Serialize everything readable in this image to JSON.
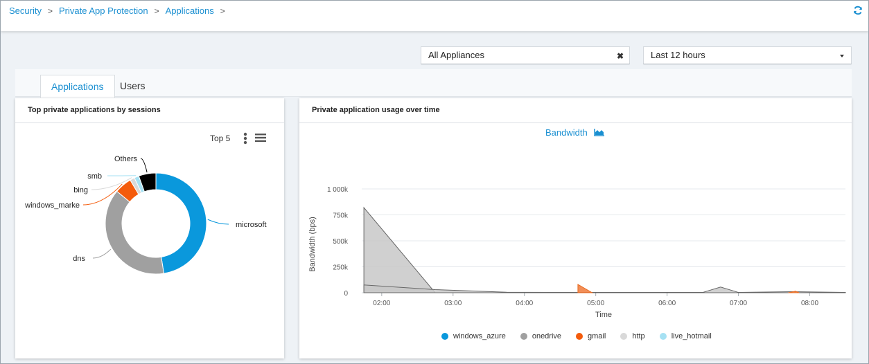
{
  "breadcrumb": {
    "items": [
      "Security",
      "Private App Protection",
      "Applications"
    ],
    "separator": ">"
  },
  "filters": {
    "appliances": {
      "value": "All Appliances"
    },
    "time_range": {
      "value": "Last 12 hours"
    }
  },
  "tabs": [
    {
      "label": "Applications",
      "active": true
    },
    {
      "label": "Users",
      "active": false
    }
  ],
  "left_card": {
    "title": "Top private applications by sessions",
    "top_n_label": "Top 5"
  },
  "right_card": {
    "title": "Private application usage over time",
    "metric_label": "Bandwidth"
  },
  "icons": {
    "refresh": "refresh-icon",
    "clear": "clear-icon",
    "dropdown": "caret-down-icon",
    "more": "kebab-menu-icon",
    "menu": "hamburger-menu-icon",
    "area_chart": "area-chart-icon"
  },
  "colors": {
    "accent": "#1a8fd1",
    "microsoft": "#0a98dc",
    "dns": "#a0a0a0",
    "windows_marke": "#f45b0b",
    "bing": "#d9d9d9",
    "smb": "#a6e1f3",
    "others": "#000000"
  },
  "chart_data": [
    {
      "type": "pie",
      "donut": true,
      "title": "Top private applications by sessions",
      "slices": [
        {
          "label": "microsoft",
          "value": 47.5,
          "color": "#0a98dc"
        },
        {
          "label": "dns",
          "value": 38.5,
          "color": "#a0a0a0"
        },
        {
          "label": "windows_marke",
          "value": 5.5,
          "color": "#f45b0b"
        },
        {
          "label": "bing",
          "value": 1.5,
          "color": "#d9d9d9"
        },
        {
          "label": "smb",
          "value": 1.5,
          "color": "#a6e1f3"
        },
        {
          "label": "Others",
          "value": 5.5,
          "color": "#000000"
        }
      ]
    },
    {
      "type": "area",
      "title": "Private application usage over time",
      "subtitle": "Bandwidth",
      "xlabel": "Time",
      "ylabel": "Bandwidth (bps)",
      "x_ticks": [
        "02:00",
        "03:00",
        "04:00",
        "05:00",
        "06:00",
        "07:00",
        "08:00"
      ],
      "y_ticks": [
        {
          "value": 0,
          "label": "0"
        },
        {
          "value": 250000,
          "label": "250k"
        },
        {
          "value": 500000,
          "label": "500k"
        },
        {
          "value": 750000,
          "label": "750k"
        },
        {
          "value": 1000000,
          "label": "1 000k"
        }
      ],
      "xlim_hours": [
        1.72,
        8.5
      ],
      "ylim": [
        0,
        1000000
      ],
      "grid": true,
      "legend_position": "bottom",
      "series": [
        {
          "name": "windows_azure",
          "color": "#0a98dc",
          "fill": "#0a98dc",
          "points": []
        },
        {
          "name": "onedrive",
          "color": "#666666",
          "fill": "#c8c8c8",
          "points": [
            [
              1.75,
              820000
            ],
            [
              2.75,
              0
            ]
          ]
        },
        {
          "name": "onedrive",
          "color": "#666666",
          "fill": "#c8c8c8",
          "points": [
            [
              1.75,
              75000
            ],
            [
              2.75,
              30000
            ],
            [
              3.75,
              5000
            ],
            [
              4.75,
              3000
            ],
            [
              5.75,
              3000
            ],
            [
              6.5,
              3000
            ],
            [
              6.75,
              55000
            ],
            [
              7.0,
              3000
            ],
            [
              7.75,
              10000
            ],
            [
              8.5,
              3000
            ]
          ]
        },
        {
          "name": "gmail",
          "color": "#e86a1f",
          "fill": "#f07a3a",
          "points": [
            [
              4.75,
              80000
            ],
            [
              4.95,
              0
            ]
          ]
        },
        {
          "name": "gmail",
          "color": "#e86a1f",
          "fill": "#f07a3a",
          "points": [
            [
              7.7,
              0
            ],
            [
              7.8,
              15000
            ],
            [
              7.85,
              0
            ]
          ]
        },
        {
          "name": "http",
          "color": "#d9d9d9",
          "fill": "#d9d9d9",
          "points": []
        },
        {
          "name": "live_hotmail",
          "color": "#a6e1f3",
          "fill": "#a6e1f3",
          "points": []
        }
      ],
      "legend": [
        {
          "name": "windows_azure",
          "color": "#0a98dc"
        },
        {
          "name": "onedrive",
          "color": "#a0a0a0"
        },
        {
          "name": "gmail",
          "color": "#f45b0b"
        },
        {
          "name": "http",
          "color": "#d9d9d9"
        },
        {
          "name": "live_hotmail",
          "color": "#a6e1f3"
        }
      ]
    }
  ]
}
